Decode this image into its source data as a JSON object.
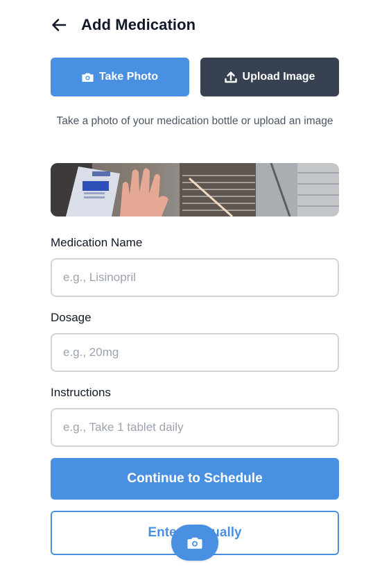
{
  "header": {
    "title": "Add Medication",
    "back_icon": "arrow-left-icon"
  },
  "actions": {
    "take_photo": {
      "label": "Take Photo",
      "icon": "camera-icon"
    },
    "upload_image": {
      "label": "Upload Image",
      "icon": "upload-icon"
    }
  },
  "hint": "Take a photo of your medication bottle or upload an image",
  "form": {
    "name": {
      "label": "Medication Name",
      "placeholder": "e.g., Lisinopril",
      "value": ""
    },
    "dosage": {
      "label": "Dosage",
      "placeholder": "e.g., 20mg",
      "value": ""
    },
    "instructions": {
      "label": "Instructions",
      "placeholder": "e.g., Take 1 tablet daily",
      "value": ""
    }
  },
  "buttons": {
    "continue": "Continue to Schedule",
    "manual": "Enter Manually"
  },
  "fab": {
    "icon": "camera-icon"
  },
  "colors": {
    "primary": "#4a90e2",
    "dark": "#374151",
    "text": "#111827",
    "muted": "#4b5563",
    "border": "#d1d5db"
  }
}
